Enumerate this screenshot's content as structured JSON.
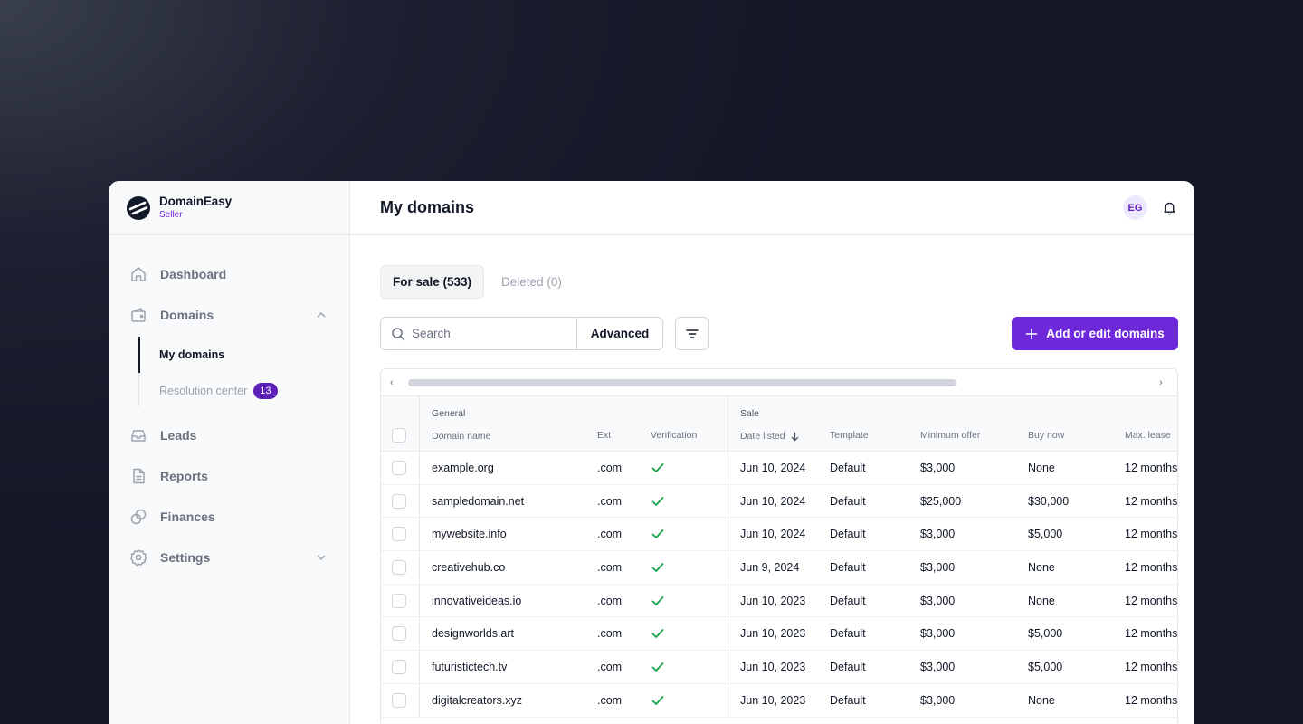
{
  "brand": {
    "name": "DomainEasy",
    "subtitle": "Seller"
  },
  "sidebar": {
    "items": [
      {
        "label": "Dashboard",
        "icon": "home-icon"
      },
      {
        "label": "Domains",
        "icon": "wallet-icon",
        "expanded": true,
        "children": [
          {
            "label": "My domains",
            "active": true
          },
          {
            "label": "Resolution center",
            "badge": "13"
          }
        ]
      },
      {
        "label": "Leads",
        "icon": "inbox-icon"
      },
      {
        "label": "Reports",
        "icon": "document-icon"
      },
      {
        "label": "Finances",
        "icon": "coins-icon"
      },
      {
        "label": "Settings",
        "icon": "gear-icon",
        "expanded": false
      }
    ]
  },
  "header": {
    "title": "My domains",
    "avatar_initials": "EG"
  },
  "tabs": [
    {
      "label": "For sale (533)",
      "active": true
    },
    {
      "label": "Deleted (0)",
      "active": false
    }
  ],
  "toolbar": {
    "search_placeholder": "Search",
    "advanced_label": "Advanced",
    "add_label": "Add or edit domains"
  },
  "table": {
    "groups": {
      "general": "General",
      "sale": "Sale"
    },
    "columns": {
      "domain": "Domain name",
      "ext": "Ext",
      "verification": "Verification",
      "date_listed": "Date listed",
      "template": "Template",
      "min_offer": "Minimum offer",
      "buy_now": "Buy now",
      "max_lease": "Max. lease"
    },
    "rows": [
      {
        "domain": "example.org",
        "ext": ".com",
        "verified": true,
        "date_listed": "Jun 10, 2024",
        "template": "Default",
        "min_offer": "$3,000",
        "buy_now": "None",
        "max_lease": "12 months"
      },
      {
        "domain": "sampledomain.net",
        "ext": ".com",
        "verified": true,
        "date_listed": "Jun 10, 2024",
        "template": "Default",
        "min_offer": "$25,000",
        "buy_now": "$30,000",
        "max_lease": "12 months"
      },
      {
        "domain": "mywebsite.info",
        "ext": ".com",
        "verified": true,
        "date_listed": "Jun 10, 2024",
        "template": "Default",
        "min_offer": "$3,000",
        "buy_now": "$5,000",
        "max_lease": "12 months"
      },
      {
        "domain": "creativehub.co",
        "ext": ".com",
        "verified": true,
        "date_listed": "Jun 9, 2024",
        "template": "Default",
        "min_offer": "$3,000",
        "buy_now": "None",
        "max_lease": "12 months"
      },
      {
        "domain": "innovativeideas.io",
        "ext": ".com",
        "verified": true,
        "date_listed": "Jun 10, 2023",
        "template": "Default",
        "min_offer": "$3,000",
        "buy_now": "None",
        "max_lease": "12 months"
      },
      {
        "domain": "designworlds.art",
        "ext": ".com",
        "verified": true,
        "date_listed": "Jun 10, 2023",
        "template": "Default",
        "min_offer": "$3,000",
        "buy_now": "$5,000",
        "max_lease": "12 months"
      },
      {
        "domain": "futuristictech.tv",
        "ext": ".com",
        "verified": true,
        "date_listed": "Jun 10, 2023",
        "template": "Default",
        "min_offer": "$3,000",
        "buy_now": "$5,000",
        "max_lease": "12 months"
      },
      {
        "domain": "digitalcreators.xyz",
        "ext": ".com",
        "verified": true,
        "date_listed": "Jun 10, 2023",
        "template": "Default",
        "min_offer": "$3,000",
        "buy_now": "None",
        "max_lease": "12 months"
      }
    ]
  },
  "colors": {
    "accent": "#6d28d9",
    "badge": "#5b21b6",
    "success": "#16a34a"
  }
}
